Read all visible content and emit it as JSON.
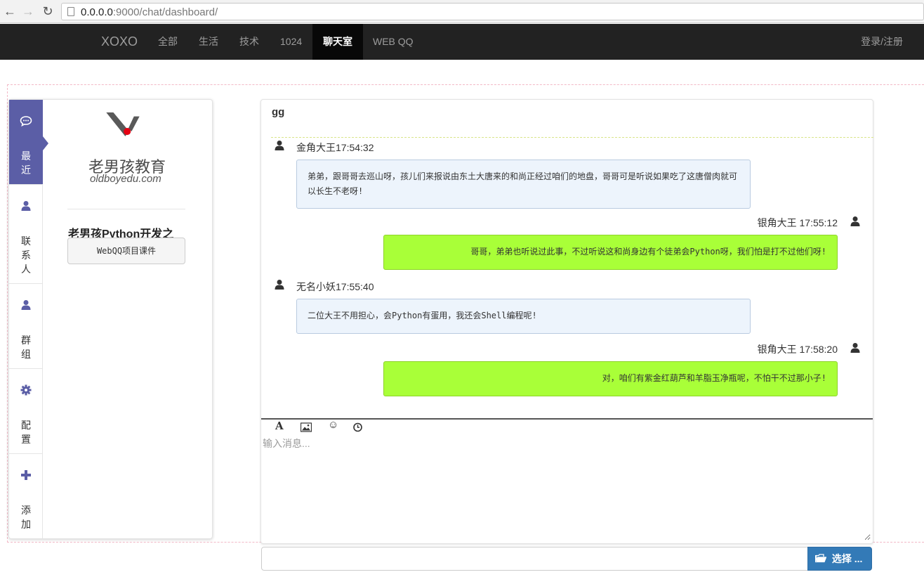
{
  "browser": {
    "url_host": "0.0.0.0",
    "url_rest": ":9000/chat/dashboard/"
  },
  "navbar": {
    "brand": "XOXO",
    "items": [
      {
        "label": "全部"
      },
      {
        "label": "生活"
      },
      {
        "label": "技术"
      },
      {
        "label": "1024"
      },
      {
        "label": "聊天室",
        "active": true
      },
      {
        "label": "WEB QQ"
      }
    ],
    "login": "登录/注册"
  },
  "sidebar": {
    "tabs": [
      {
        "label": "最近",
        "icon": "comment-icon",
        "active": true
      },
      {
        "label": "联系人",
        "icon": "user-icon"
      },
      {
        "label": "群组",
        "icon": "user-icon"
      },
      {
        "label": "配置",
        "icon": "gear-icon"
      },
      {
        "label": "添加",
        "icon": "plus-icon"
      }
    ],
    "logo_cn": "老男孩教育",
    "logo_en": "oldboyedu.com",
    "course_title": "老男孩Python开发之",
    "course_button": "WebQQ项目课件"
  },
  "chat": {
    "title": "gg",
    "messages": [
      {
        "side": "left",
        "sender": "金角大王",
        "time": "17:54:32",
        "text": "弟弟，跟哥哥去巡山呀，孩儿们来报说由东土大唐来的和尚正经过咱们的地盘，哥哥可是听说如果吃了这唐僧肉就可以长生不老呀!"
      },
      {
        "side": "right",
        "sender": "银角大王",
        "time": "17:55:12",
        "text": "哥哥，弟弟也听说过此事，不过听说这和尚身边有个徒弟会Python呀，我们怕是打不过他们呀!"
      },
      {
        "side": "left",
        "sender": "无名小妖",
        "time": "17:55:40",
        "text": "二位大王不用担心，会Python有蛋用，我还会Shell编程呢!"
      },
      {
        "side": "right",
        "sender": "银角大王",
        "time": "17:58:20",
        "text": "对，咱们有紫金红葫芦和羊脂玉净瓶呢，不怕干不过那小子!"
      }
    ],
    "toolbar": [
      {
        "icon": "font-icon",
        "glyph": "A"
      },
      {
        "icon": "image-icon",
        "glyph": ""
      },
      {
        "icon": "smiley-icon",
        "glyph": "☺"
      },
      {
        "icon": "clock-icon",
        "glyph": ""
      }
    ],
    "input_placeholder": "输入消息..."
  },
  "upload": {
    "button_label": "选择 ..."
  }
}
